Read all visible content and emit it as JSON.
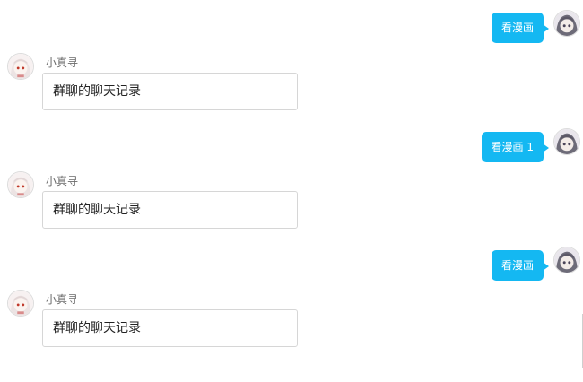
{
  "chat": {
    "sent": [
      {
        "text": "看漫画"
      },
      {
        "text": "看漫画 1"
      },
      {
        "text": "看漫画"
      }
    ],
    "received": [
      {
        "sender": "小真寻",
        "text": "群聊的聊天记录"
      },
      {
        "sender": "小真寻",
        "text": "群聊的聊天记录"
      },
      {
        "sender": "小真寻",
        "text": "群聊的聊天记录"
      }
    ]
  },
  "colors": {
    "sent_bubble": "#14b8f2",
    "sent_text": "#ffffff",
    "received_border": "#d6d6d6",
    "sender_name": "#6a6a6a"
  },
  "icons": {
    "self_avatar": "user-avatar-icon",
    "bot_avatar": "bot-avatar-icon"
  }
}
